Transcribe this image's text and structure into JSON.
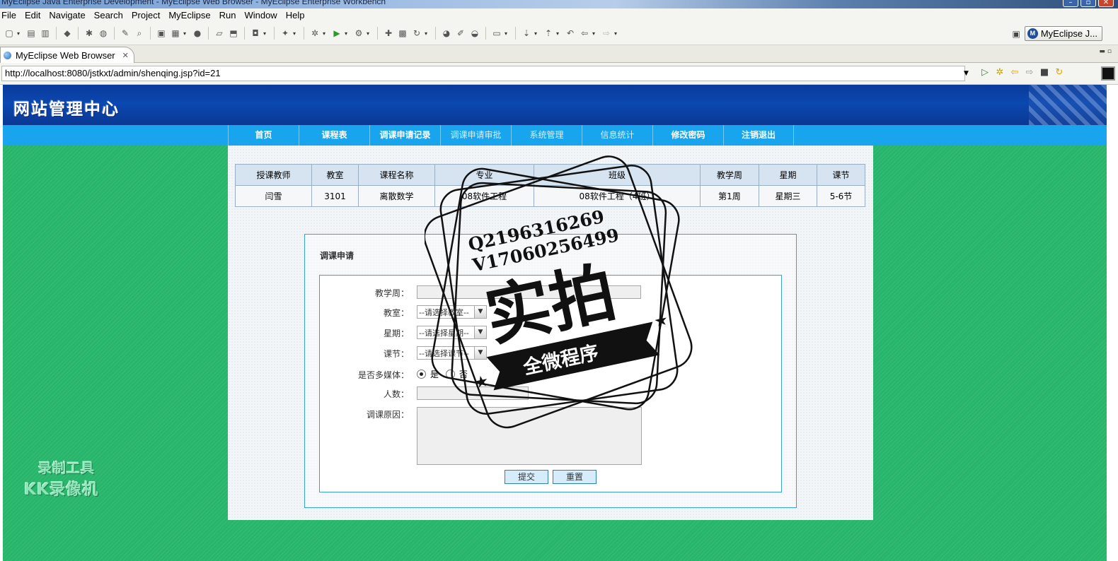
{
  "window": {
    "title": "MyEclipse Java Enterprise Development - MyEclipse Web Browser - MyEclipse Enterprise Workbench"
  },
  "menu": [
    "File",
    "Edit",
    "Navigate",
    "Search",
    "Project",
    "MyEclipse",
    "Run",
    "Window",
    "Help"
  ],
  "perspective": {
    "label": "MyEclipse J..."
  },
  "editor_tab": {
    "label": "MyEclipse Web Browser"
  },
  "browser": {
    "url": "http://localhost:8080/jstkxt/admin/shenqing.jsp?id=21"
  },
  "site": {
    "title": "网站管理中心",
    "nav": [
      "首页",
      "课程表",
      "调课申请记录",
      "调课申请审批",
      "系统管理",
      "信息统计",
      "修改密码",
      "注销退出"
    ]
  },
  "course_table": {
    "columns": [
      "授课教师",
      "教室",
      "课程名称",
      "专业",
      "班级",
      "教学周",
      "星期",
      "课节"
    ],
    "rows": [
      [
        "闫雪",
        "3101",
        "离散数学",
        "08软件工程",
        "08软件工程（4班）",
        "第1周",
        "星期三",
        "5-6节"
      ]
    ]
  },
  "form": {
    "title": "调课申请",
    "week_label": "教学周：",
    "room_label": "教室：",
    "room_value": "--请选择教室--",
    "day_label": "星期：",
    "day_value": "--请选择星期--",
    "period_label": "课节：",
    "period_value": "--请选择课节--",
    "multimedia_label": "是否多媒体：",
    "multimedia_yes": "是",
    "multimedia_no": "否",
    "count_label": "人数：",
    "reason_label": "调课原因：",
    "submit_label": "提交",
    "reset_label": "重置"
  },
  "watermark": {
    "recorder_line1": "录制工具",
    "recorder_line2": "KK录像机",
    "stamp_q": "Q2196316269",
    "stamp_v": "V17060256499",
    "stamp_main": "实拍",
    "stamp_banner": "全微程序"
  },
  "colors": {
    "header_blue": "#0b48b0",
    "nav_blue": "#18a5ee",
    "page_green": "#26b56a",
    "form_border": "#3aa0d8"
  }
}
